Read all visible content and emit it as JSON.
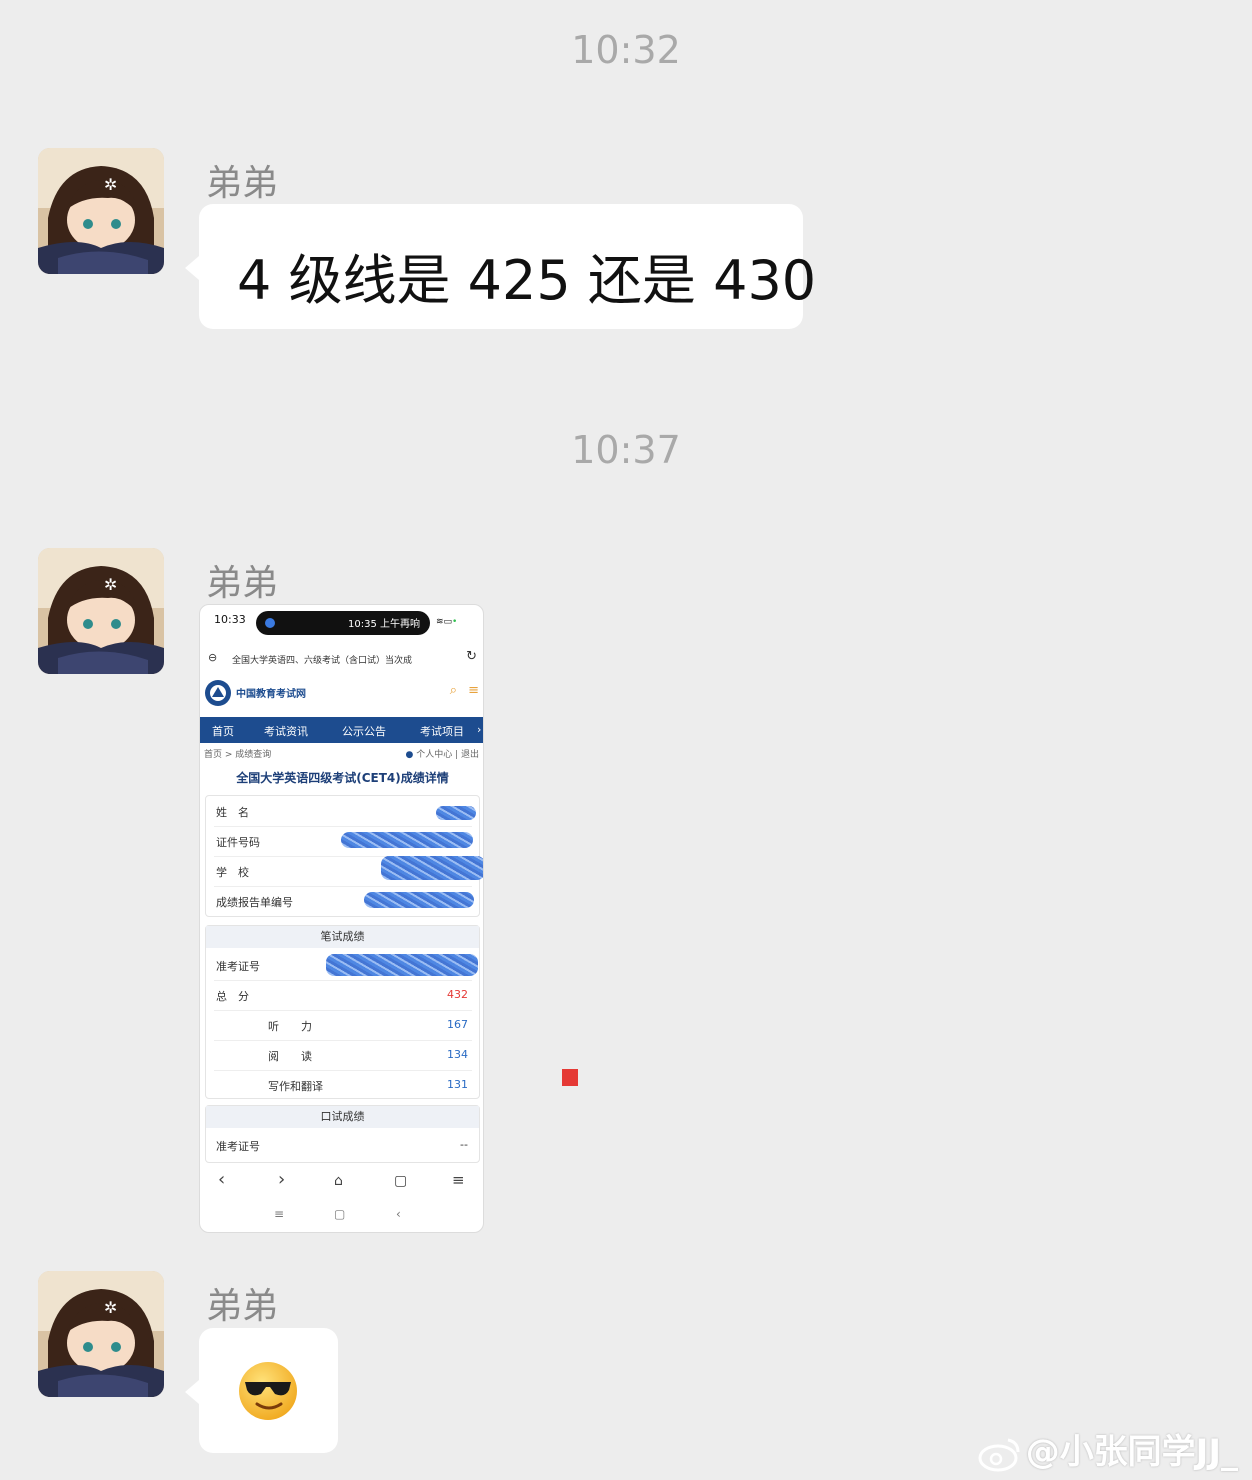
{
  "chat": {
    "messages": [
      {
        "timestamp": "10:32",
        "sender": "弟弟",
        "type": "text",
        "text": "4 级线是 425 还是 430"
      },
      {
        "timestamp": "10:37",
        "sender": "弟弟",
        "type": "image"
      },
      {
        "sender": "弟弟",
        "type": "emoji",
        "emoji": "😎"
      }
    ]
  },
  "screenshot": {
    "status_time": "10:33",
    "island_text": "10:35 上午再响",
    "url_text": "全国大学英语四、六级考试（含口试）当次成",
    "site_name": "中国教育考试网",
    "nav": [
      "首页",
      "考试资讯",
      "公示公告",
      "考试项目"
    ],
    "breadcrumb": "首页 > 成绩查询",
    "user_links": "个人中心 | 退出",
    "page_title": "全国大学英语四级考试(CET4)成绩详情",
    "info_rows": [
      {
        "label": "姓　名"
      },
      {
        "label": "证件号码"
      },
      {
        "label": "学　校"
      },
      {
        "label": "成绩报告单编号"
      }
    ],
    "written": {
      "title": "笔试成绩",
      "ticket_label": "准考证号",
      "total_label": "总　分",
      "total_value": "432",
      "items": [
        {
          "label": "听　　力",
          "value": "167"
        },
        {
          "label": "阅　　读",
          "value": "134"
        },
        {
          "label": "写作和翻译",
          "value": "131"
        }
      ]
    },
    "oral": {
      "title": "口试成绩",
      "ticket_label": "准考证号",
      "ticket_value": "--"
    },
    "toolbar_icons": [
      "back-icon",
      "forward-icon",
      "home-icon",
      "tabs-icon",
      "menu-icon"
    ]
  },
  "watermark": "@小张同学JJ_",
  "colors": {
    "background": "#ededed",
    "bubble": "#ffffff",
    "total_score": "#e53935",
    "nav": "#1d4c8f"
  }
}
